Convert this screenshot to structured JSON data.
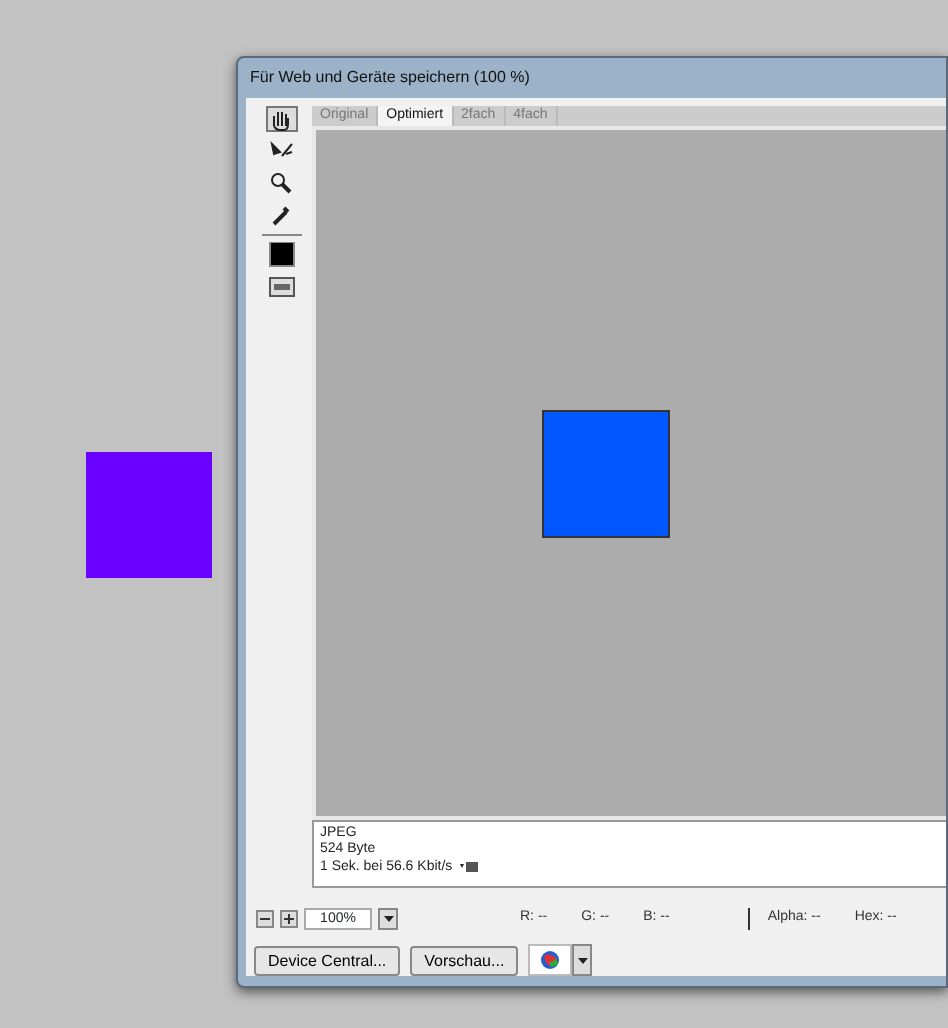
{
  "window": {
    "title": "Für Web und Geräte speichern (100 %)"
  },
  "tools": [
    {
      "kind": "hand",
      "selected": true
    },
    {
      "kind": "slice",
      "selected": false
    },
    {
      "kind": "zoom",
      "selected": false
    },
    {
      "kind": "eyedropper",
      "selected": false
    },
    {
      "kind": "swatch",
      "selected": false
    },
    {
      "kind": "toggle",
      "selected": false
    }
  ],
  "tabs": [
    {
      "label": "Original",
      "selected": false
    },
    {
      "label": "Optimiert",
      "selected": true
    },
    {
      "label": "2fach",
      "selected": false
    },
    {
      "label": "4fach",
      "selected": false
    }
  ],
  "info": {
    "lines": [
      "JPEG",
      "524 Byte",
      "1 Sek. bei 56.6 Kbit/s"
    ]
  },
  "zoom": {
    "value": "100%"
  },
  "readouts": [
    "R: --",
    "G: --",
    "B: --",
    "Alpha: --",
    "Hex: --"
  ],
  "buttons": [
    "Device Central...",
    "Vorschau..."
  ]
}
